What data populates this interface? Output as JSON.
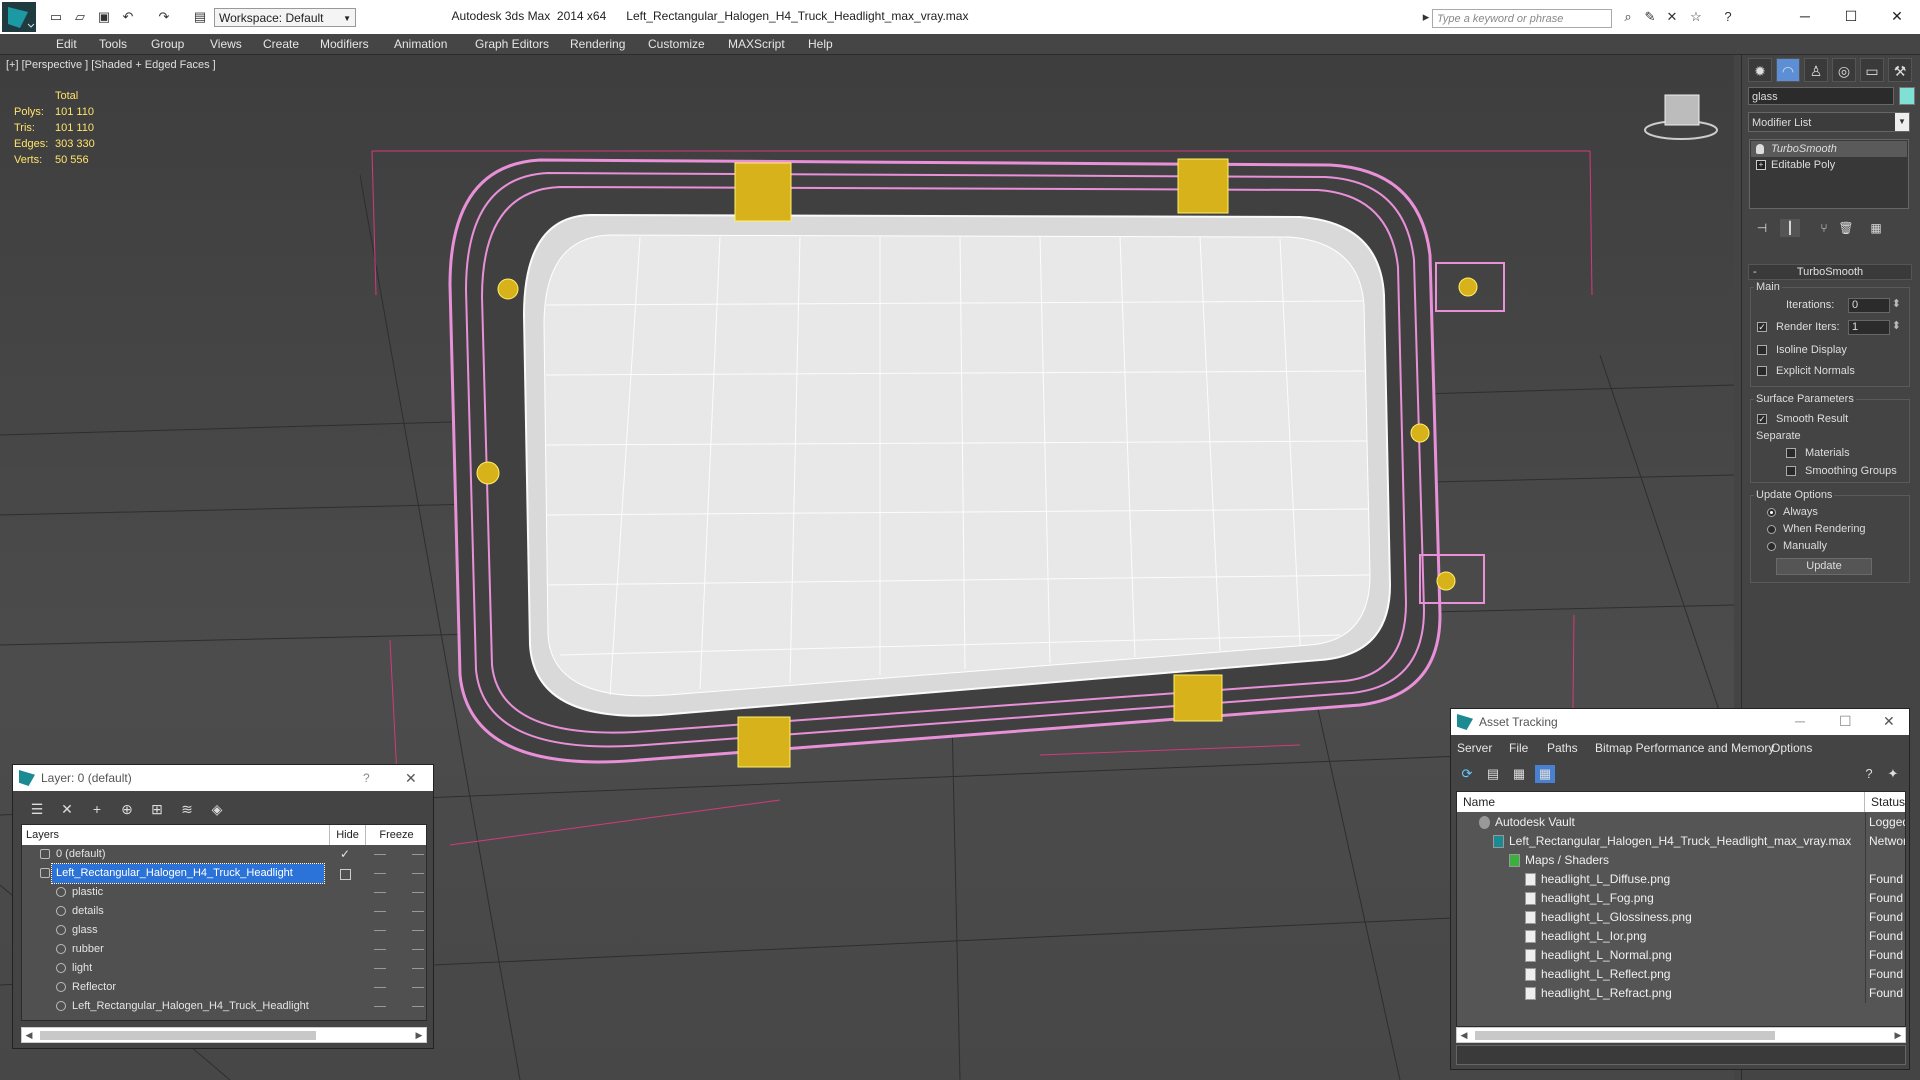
{
  "window": {
    "title": "Autodesk 3ds Max  2014 x64      Left_Rectangular_Halogen_H4_Truck_Headlight_max_vray.max",
    "workspace": "Workspace: Default",
    "search_placeholder": "Type a keyword or phrase"
  },
  "menu": [
    "Edit",
    "Tools",
    "Group",
    "Views",
    "Create",
    "Modifiers",
    "Animation",
    "Graph Editors",
    "Rendering",
    "Customize",
    "MAXScript",
    "Help"
  ],
  "viewport": {
    "label": "[+] [Perspective ] [Shaded + Edged Faces ]",
    "stats": {
      "header": "Total",
      "rows": [
        {
          "label": "Polys:",
          "value": "101 110"
        },
        {
          "label": "Tris:",
          "value": "101 110"
        },
        {
          "label": "Edges:",
          "value": "303 330"
        },
        {
          "label": "Verts:",
          "value": "50 556"
        }
      ]
    }
  },
  "command_panel": {
    "object_name": "glass",
    "object_color": "#7fe0d6",
    "modifier_list": "Modifier List",
    "stack": [
      "TurboSmooth",
      "Editable Poly"
    ],
    "rollout_title": "TurboSmooth",
    "main_group": "Main",
    "iterations_label": "Iterations:",
    "iterations_value": "0",
    "render_iters_label": "Render Iters:",
    "render_iters_value": "1",
    "render_iters_checked": true,
    "isoline_label": "Isoline Display",
    "explicit_normals_label": "Explicit Normals",
    "surface_group": "Surface Parameters",
    "smooth_result_label": "Smooth Result",
    "separate_label": "Separate",
    "materials_label": "Materials",
    "smoothing_groups_label": "Smoothing Groups",
    "update_group": "Update Options",
    "update_always": "Always",
    "update_rendering": "When Rendering",
    "update_manually": "Manually",
    "update_button": "Update"
  },
  "layer_panel": {
    "title": "Layer: 0 (default)",
    "help": "?",
    "close": "✕",
    "columns": [
      "Layers",
      "Hide",
      "Freeze"
    ],
    "rows": [
      {
        "name": "0 (default)",
        "indent": 0,
        "selected": false,
        "checked": true
      },
      {
        "name": "Left_Rectangular_Halogen_H4_Truck_Headlight",
        "indent": 0,
        "selected": true,
        "checked": false
      },
      {
        "name": "plastic",
        "indent": 1,
        "selected": false,
        "checked": false
      },
      {
        "name": "details",
        "indent": 1,
        "selected": false,
        "checked": false
      },
      {
        "name": "glass",
        "indent": 1,
        "selected": false,
        "checked": false
      },
      {
        "name": "rubber",
        "indent": 1,
        "selected": false,
        "checked": false
      },
      {
        "name": "light",
        "indent": 1,
        "selected": false,
        "checked": false
      },
      {
        "name": "Reflector",
        "indent": 1,
        "selected": false,
        "checked": false
      },
      {
        "name": "Left_Rectangular_Halogen_H4_Truck_Headlight",
        "indent": 1,
        "selected": false,
        "checked": false
      }
    ]
  },
  "asset_panel": {
    "title": "Asset Tracking",
    "menu": [
      "Server",
      "File",
      "Paths",
      "Bitmap Performance and Memory",
      "Options"
    ],
    "columns": [
      "Name",
      "Status"
    ],
    "rows": [
      {
        "name": "Autodesk Vault",
        "indent": 1,
        "status": "Logged"
      },
      {
        "name": "Left_Rectangular_Halogen_H4_Truck_Headlight_max_vray.max",
        "indent": 2,
        "status": "Network"
      },
      {
        "name": "Maps / Shaders",
        "indent": 3,
        "status": ""
      },
      {
        "name": "headlight_L_Diffuse.png",
        "indent": 4,
        "status": "Found"
      },
      {
        "name": "headlight_L_Fog.png",
        "indent": 4,
        "status": "Found"
      },
      {
        "name": "headlight_L_Glossiness.png",
        "indent": 4,
        "status": "Found"
      },
      {
        "name": "headlight_L_Ior.png",
        "indent": 4,
        "status": "Found"
      },
      {
        "name": "headlight_L_Normal.png",
        "indent": 4,
        "status": "Found"
      },
      {
        "name": "headlight_L_Reflect.png",
        "indent": 4,
        "status": "Found"
      },
      {
        "name": "headlight_L_Refract.png",
        "indent": 4,
        "status": "Found"
      }
    ]
  }
}
